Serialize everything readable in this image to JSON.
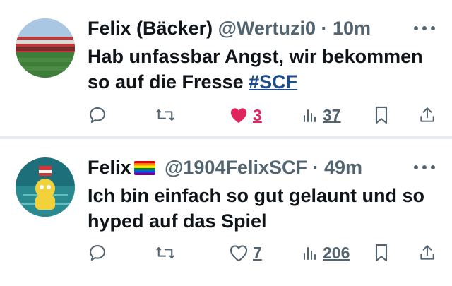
{
  "tweets": [
    {
      "author_name": "Felix (Bäcker)",
      "handle": "@Wertuzi0",
      "separator": "·",
      "time": "10m",
      "text": "Hab unfassbar Angst, wir bekommen so auf die Fresse",
      "hashtag": "#SCF",
      "like_count": "3",
      "view_count": "37",
      "liked": true
    },
    {
      "author_name": "Felix",
      "flag_icon": "rainbow-flag-icon",
      "handle": "@1904FelixSCF",
      "separator": "·",
      "time": "49m",
      "text": "Ich bin einfach so gut gelaunt und so hyped auf das Spiel",
      "like_count": "7",
      "view_count": "206",
      "liked": false
    }
  ],
  "colors": {
    "text": "#0f1419",
    "muted": "#536471",
    "like_active": "#e0245e",
    "hashtag": "#1d4e89",
    "separator": "#e6eaed"
  }
}
